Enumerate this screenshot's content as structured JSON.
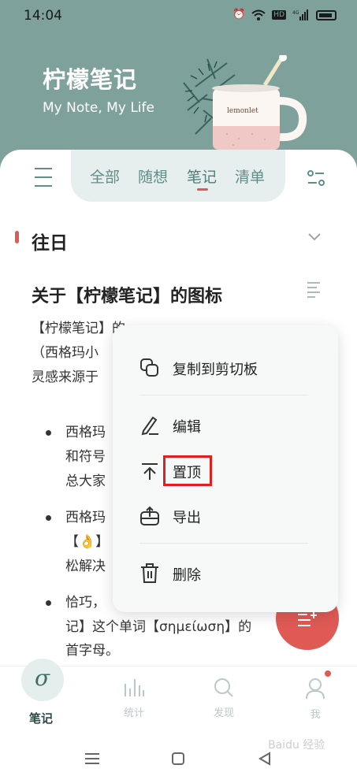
{
  "status": {
    "time": "14:04",
    "net": "4G",
    "hd": "HD"
  },
  "header": {
    "title": "柠檬笔记",
    "subtitle": "My Note, My Life",
    "mug_text": "lemonlet"
  },
  "tabs": [
    {
      "label": "全部"
    },
    {
      "label": "随想"
    },
    {
      "label": "笔记"
    },
    {
      "label": "清单"
    }
  ],
  "section": {
    "title": "往日"
  },
  "note": {
    "title": "关于【柠檬笔记】的图标",
    "line1": "【柠檬笔记】的",
    "line2": "（西格玛小",
    "line3": "灵感来源于",
    "b1_l1": "西格玛",
    "b1_l2": "和符号",
    "b1_l3": "总大家",
    "b2_l1": "西格玛",
    "b2_l2": "【👌】",
    "b2_l3": "松解决",
    "b3_l1": "恰巧，",
    "b3_l2": "记】这个单词【σημείωση】的",
    "b3_l3": "首字母。"
  },
  "popup": {
    "copy": "复制到剪切板",
    "edit": "编辑",
    "pin": "置顶",
    "export": "导出",
    "delete": "删除"
  },
  "nav": {
    "note": "笔记",
    "stats": "统计",
    "discover": "发现",
    "me": "我"
  },
  "watermark": "Baidu 经验"
}
